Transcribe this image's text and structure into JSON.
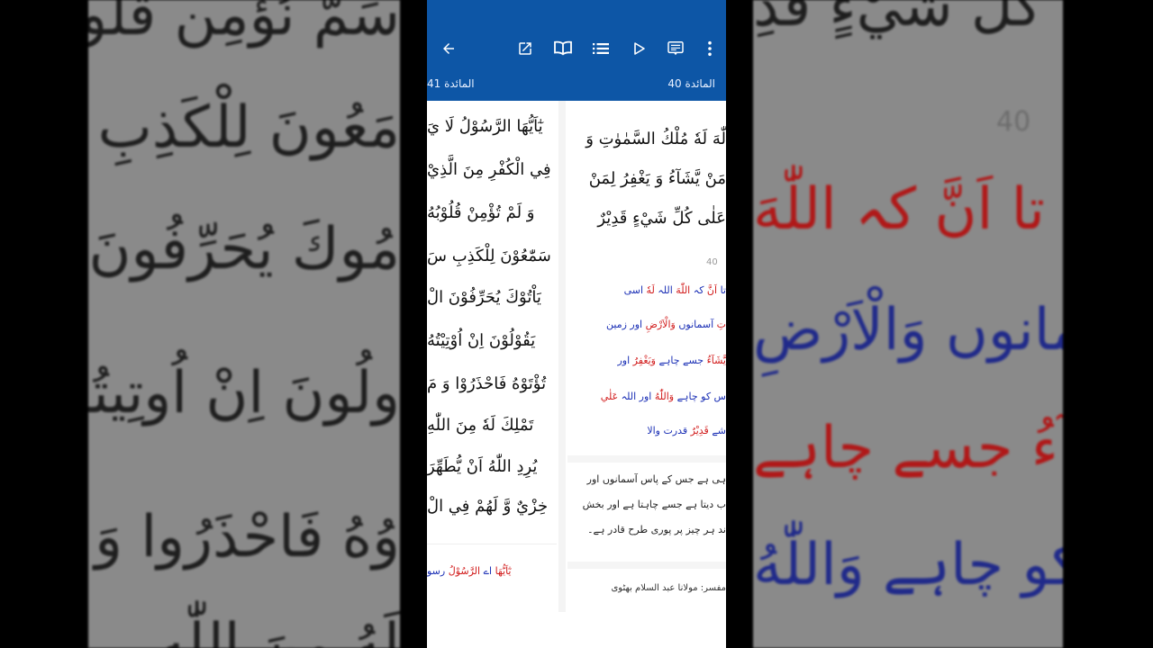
{
  "background": {
    "left_lines": [
      "سَمَّ نُؤْمِن قُلُوبُهُ",
      "مَعُونَ لِلْكَذِبِ سَمّ",
      "مُوكَ يُحَرِّفُونَ الْ",
      "ولُونَ اِنْ اُوتِيتُهُ",
      "وُهُ فَاحْذَرُوا وَ مَ",
      "لَهُ مِنَ اللّٰهِ"
    ],
    "right_lines": [
      "عَلَى كُلِّ شَيْءٍ قَدِ",
      "تا اَنَّ كہ اللّٰهَ",
      "تِ آسمانوں وَالْاَرْضِ",
      "يَّشَآءُ جسے چاہے",
      "ں کو چاہے وَاللّٰهُ"
    ],
    "right_number": "40"
  },
  "toolbar": {
    "back_icon": "arrow-left-icon",
    "open_icon": "open-external-icon",
    "book_icon": "open-book-icon",
    "list_icon": "list-icon",
    "play_icon": "play-icon",
    "translate_icon": "translate-icon",
    "more_icon": "more-vertical-icon",
    "page_tab_current": "المائدة 40",
    "page_tab_next": "المائدة 41"
  },
  "right_column": {
    "arabic_lines": [
      "لّٰهَ لَهٗ مُلْكُ السَّمٰوٰتِ وَ",
      "مَنْ يَّشَآءُ وَ يَغْفِرُ لِمَنْ",
      "عَلٰى كُلِّ شَيْءٍ قَدِيْرٌ"
    ],
    "verse_number": "40",
    "wbw_lines": [
      [
        {
          "t": "تا ",
          "c": "b"
        },
        {
          "t": "اَنَّ ",
          "c": "r"
        },
        {
          "t": "كہ ",
          "c": "b"
        },
        {
          "t": "اللّٰهَ ",
          "c": "r"
        },
        {
          "t": "اللہ ",
          "c": "b"
        },
        {
          "t": "لَهٗ ",
          "c": "r"
        },
        {
          "t": "اسی",
          "c": "b"
        }
      ],
      [
        {
          "t": "تِ ",
          "c": "r"
        },
        {
          "t": "آسمانوں ",
          "c": "b"
        },
        {
          "t": "وَالْاَرْضِ ",
          "c": "r"
        },
        {
          "t": "اور زمین",
          "c": "b"
        }
      ],
      [
        {
          "t": "يَّشَآءُ ",
          "c": "r"
        },
        {
          "t": "جسے چاہے ",
          "c": "b"
        },
        {
          "t": "وَيَغْفِرُ ",
          "c": "r"
        },
        {
          "t": "اور",
          "c": "b"
        }
      ],
      [
        {
          "t": "س کو چاہے ",
          "c": "b"
        },
        {
          "t": "وَاللّٰهُ ",
          "c": "r"
        },
        {
          "t": "اور اللہ ",
          "c": "b"
        },
        {
          "t": "عَلٰي",
          "c": "r"
        }
      ],
      [
        {
          "t": "شے ",
          "c": "b"
        },
        {
          "t": "قَدِيْرٌ ",
          "c": "r"
        },
        {
          "t": "قدرت والا",
          "c": "b"
        }
      ]
    ],
    "translation_lines": [
      "ہی ہے جس کے پاس آسمانوں اور",
      "ب دیتا ہے جسے چاہتا ہے اور بخش",
      "ند ہر چیز پر پوری طرح قادر ہے۔"
    ],
    "mufassir": "مفسر: مولانا عبد السلام بھٹوی"
  },
  "left_column": {
    "arabic_lines": [
      "يٰٓاَيُّهَا الرَّسُوْلُ لَا يَ",
      "فِي الْكُفْرِ مِنَ الَّذِيْ",
      "وَ لَمْ تُؤْمِنْ قُلُوْبُهُ",
      "سَمّٰعُوْنَ لِلْكَذِبِ سَ",
      "يَاْتُوْكَ يُحَرِّفُوْنَ الْ",
      "يَقُوْلُوْنَ اِنْ اُوْتِيْتُهُ",
      "تُؤْتَوْهُ فَاحْذَرُوْا وَ مَ",
      "تَمْلِكَ لَهٗ مِنَ اللّٰهِ",
      "يُرِدِ اللّٰهُ اَنْ يُّطَهِّرَ",
      "خِزْيٌ وَّ لَهُمْ فِي الْ"
    ],
    "wbw_first": [
      {
        "t": "يٰٓاَيُّهَا ",
        "c": "r"
      },
      {
        "t": "اے ",
        "c": "b"
      },
      {
        "t": "الرَّسُوْلُ ",
        "c": "r"
      },
      {
        "t": "رسو",
        "c": "b"
      }
    ]
  },
  "colors": {
    "appbar": "#0d56a6",
    "word_red": "#d11a1a",
    "word_blue": "#1a2fb5"
  }
}
